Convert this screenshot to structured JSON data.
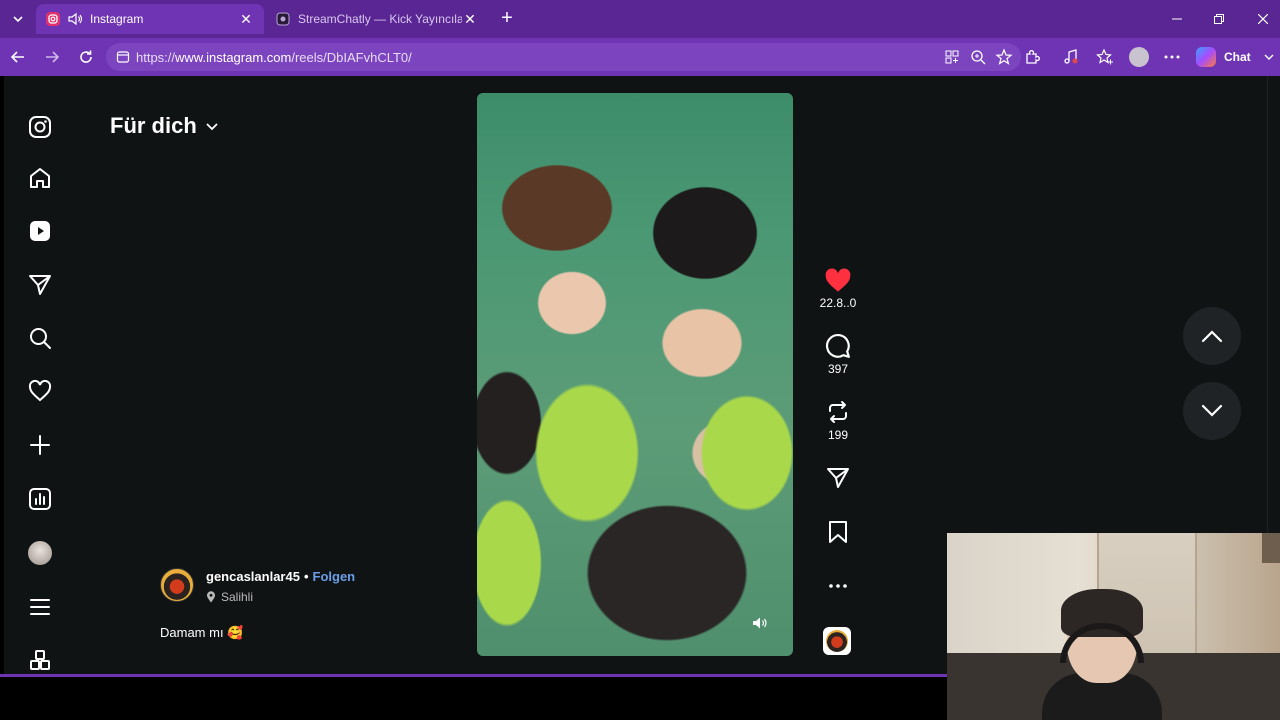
{
  "browser": {
    "tabs": [
      {
        "title": "Instagram",
        "active": true
      },
      {
        "title": "StreamChatly — Kick Yayıncıları için",
        "active": false
      }
    ],
    "url_prefix": "https://",
    "url_host": "www.instagram.com",
    "url_path": "/reels/DbIAFvhCLT0/",
    "chat_label": "Chat",
    "accent_color": "#6f34b3"
  },
  "page": {
    "feed_title": "Für dich",
    "sidebar_icons": [
      "instagram-logo-icon",
      "home-icon",
      "reels-icon",
      "direct-send-icon",
      "search-icon",
      "heart-icon",
      "create-plus-icon",
      "insights-icon",
      "profile-avatar",
      "menu-icon",
      "more-apps-icon"
    ]
  },
  "reel": {
    "likes": "22.8..0",
    "comments": "397",
    "reposts": "199",
    "author": "gencaslanlar45",
    "separator": "•",
    "follow_label": "Folgen",
    "location": "Salihli",
    "caption": "Damam mı 🥰"
  }
}
